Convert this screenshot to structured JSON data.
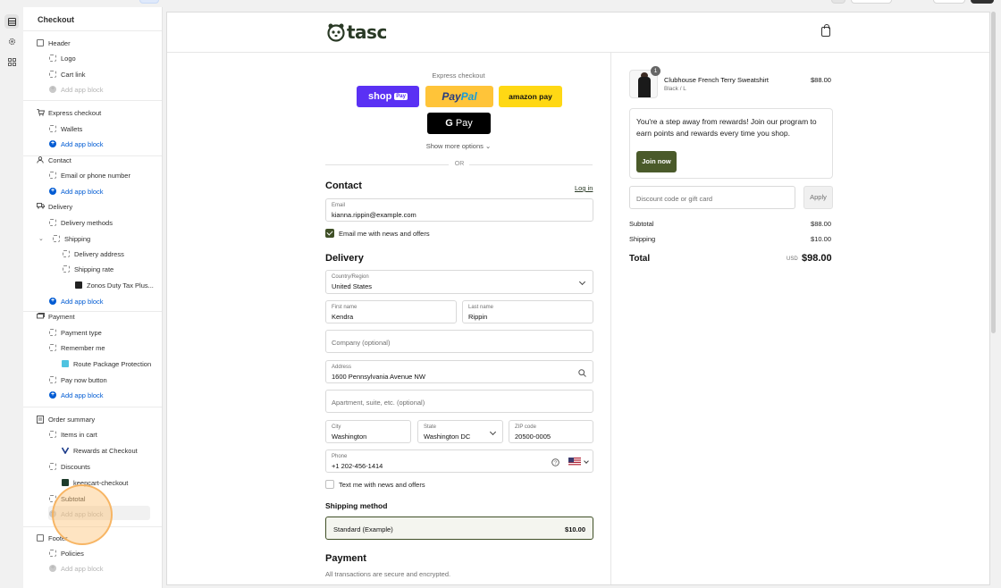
{
  "sidebar": {
    "title": "Checkout",
    "sections": [
      {
        "label": "Header",
        "icon": "layout-section-icon",
        "items": [
          {
            "label": "Logo",
            "kind": "block"
          },
          {
            "label": "Cart link",
            "kind": "block"
          },
          {
            "label": "Add app block",
            "kind": "add-muted"
          }
        ]
      },
      {
        "label": "Express checkout",
        "icon": "cart-icon",
        "items": [
          {
            "label": "Wallets",
            "kind": "block"
          },
          {
            "label": "Add app block",
            "kind": "add"
          }
        ]
      },
      {
        "label": "Contact",
        "icon": "person-icon",
        "items": [
          {
            "label": "Email or phone number",
            "kind": "block"
          },
          {
            "label": "Add app block",
            "kind": "add"
          }
        ]
      },
      {
        "label": "Delivery",
        "icon": "truck-icon",
        "items": [
          {
            "label": "Delivery methods",
            "kind": "block"
          },
          {
            "label": "Shipping",
            "kind": "block-expanded"
          },
          {
            "label": "Delivery address",
            "kind": "sub-block"
          },
          {
            "label": "Shipping rate",
            "kind": "sub-block"
          },
          {
            "label": "Zonos Duty Tax Plus...",
            "kind": "sub-app"
          },
          {
            "label": "Add app block",
            "kind": "add"
          }
        ]
      },
      {
        "label": "Payment",
        "icon": "cash-icon",
        "items": [
          {
            "label": "Payment type",
            "kind": "block"
          },
          {
            "label": "Remember me",
            "kind": "block"
          },
          {
            "label": "Route Package Protection",
            "kind": "sub-app"
          },
          {
            "label": "Pay now button",
            "kind": "block"
          },
          {
            "label": "Add app block",
            "kind": "add"
          }
        ]
      },
      {
        "label": "Order summary",
        "icon": "receipt-icon",
        "items": [
          {
            "label": "Items in cart",
            "kind": "block"
          },
          {
            "label": "Rewards at Checkout",
            "kind": "sub-app"
          },
          {
            "label": "Discounts",
            "kind": "block"
          },
          {
            "label": "keepcart-checkout",
            "kind": "sub-app"
          },
          {
            "label": "Subtotal",
            "kind": "block"
          },
          {
            "label": "Add app block",
            "kind": "add-muted"
          }
        ]
      },
      {
        "label": "Footer",
        "icon": "layout-section-icon",
        "items": [
          {
            "label": "Policies",
            "kind": "block"
          },
          {
            "label": "Add app block",
            "kind": "add-muted"
          }
        ]
      }
    ]
  },
  "store": {
    "brand": "tasc"
  },
  "express": {
    "title": "Express checkout",
    "shop_pay": "shop",
    "shop_pay_badge": "Pay",
    "paypal_a": "Pay",
    "paypal_b": "Pal",
    "amazon_pay": "amazon pay",
    "gpay_g": "G",
    "gpay_pay": "Pay",
    "show_more": "Show more options",
    "or": "OR"
  },
  "contact": {
    "heading": "Contact",
    "login": "Log in",
    "email_label": "Email",
    "email_value": "kianna.rippin@example.com",
    "email_offers": "Email me with news and offers"
  },
  "delivery": {
    "heading": "Delivery",
    "country_label": "Country/Region",
    "country_value": "United States",
    "first_name_label": "First name",
    "first_name_value": "Kendra",
    "last_name_label": "Last name",
    "last_name_value": "Rippin",
    "company_placeholder": "Company (optional)",
    "address_label": "Address",
    "address_value": "1600 Pennsylvania Avenue NW",
    "apartment_placeholder": "Apartment, suite, etc. (optional)",
    "city_label": "City",
    "city_value": "Washington",
    "state_label": "State",
    "state_value": "Washington DC",
    "zip_label": "ZIP code",
    "zip_value": "20500-0005",
    "phone_label": "Phone",
    "phone_value": "+1 202-456-1414",
    "text_offers": "Text me with news and offers"
  },
  "shipping": {
    "heading": "Shipping method",
    "option_name": "Standard (Example)",
    "option_price": "$10.00"
  },
  "payment": {
    "heading": "Payment",
    "subtitle": "All transactions are secure and encrypted."
  },
  "summary": {
    "qty": "1",
    "product_name": "Clubhouse French Terry Sweatshirt",
    "product_variant": "Black / L",
    "product_price": "$88.00",
    "rewards_message": "You're a step away from rewards! Join our program to earn points and rewards every time you shop.",
    "join_label": "Join now",
    "discount_placeholder": "Discount code or gift card",
    "apply_label": "Apply",
    "subtotal_label": "Subtotal",
    "subtotal_value": "$88.00",
    "shipping_label": "Shipping",
    "shipping_value": "$10.00",
    "total_label": "Total",
    "currency": "USD",
    "total_value": "$98.00"
  },
  "colors": {
    "accent_blue": "#005bd3",
    "brand_green": "#3f4f26",
    "shop_pay": "#5a31f4",
    "paypal": "#ffc439",
    "amazon": "#ffd814"
  }
}
